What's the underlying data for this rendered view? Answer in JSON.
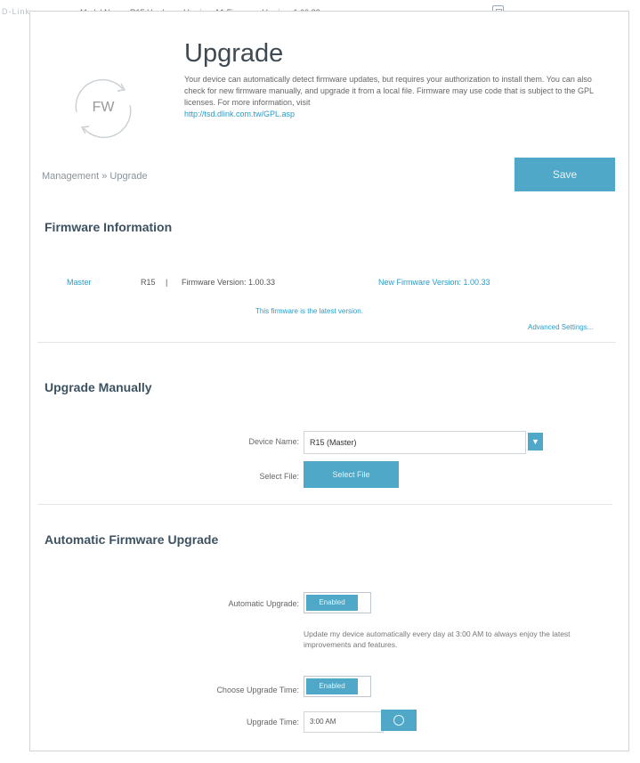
{
  "topbar": {
    "logo": "D-Link",
    "info": "Model Name: R15   Hardware Version: A1   Firmware Version: 1.00.33"
  },
  "hero": {
    "title": "Upgrade",
    "logo_text": "FW",
    "description": "Your device can automatically detect firmware updates, but requires your authorization to install them. You can also check for new firmware manually, and upgrade it from a local file. Firmware may use code that is subject to the GPL licenses. For more information, visit",
    "link": "http://tsd.dlink.com.tw/GPL.asp"
  },
  "breadcrumb": "Management » Upgrade",
  "save_label": "Save",
  "firmware_info": {
    "title": "Firmware Information",
    "model_label": "Master",
    "model_value": "R15",
    "separator": "|",
    "current": "Firmware Version: 1.00.33",
    "new": "New Firmware Version: 1.00.33",
    "latest_note": "This firmware is the latest version.",
    "advanced": "Advanced Settings..."
  },
  "manual": {
    "title": "Upgrade Manually",
    "device_label": "Device Name:",
    "device_value": "R15 (Master)",
    "file_label": "Select File:",
    "file_button": "Select File"
  },
  "auto": {
    "title": "Automatic Firmware Upgrade",
    "auto_label": "Automatic Upgrade:",
    "auto_state": "Enabled",
    "auto_desc": "Update my device automatically every day at 3:00 AM to always enjoy the latest improvements and features.",
    "choose_label": "Choose Upgrade Time:",
    "choose_state": "Enabled",
    "time_label": "Upgrade Time:",
    "time_value": "3:00 AM"
  },
  "colors": {
    "accent": "#4fa8c7",
    "link": "#2a9bc4",
    "heading": "#3d5260"
  }
}
